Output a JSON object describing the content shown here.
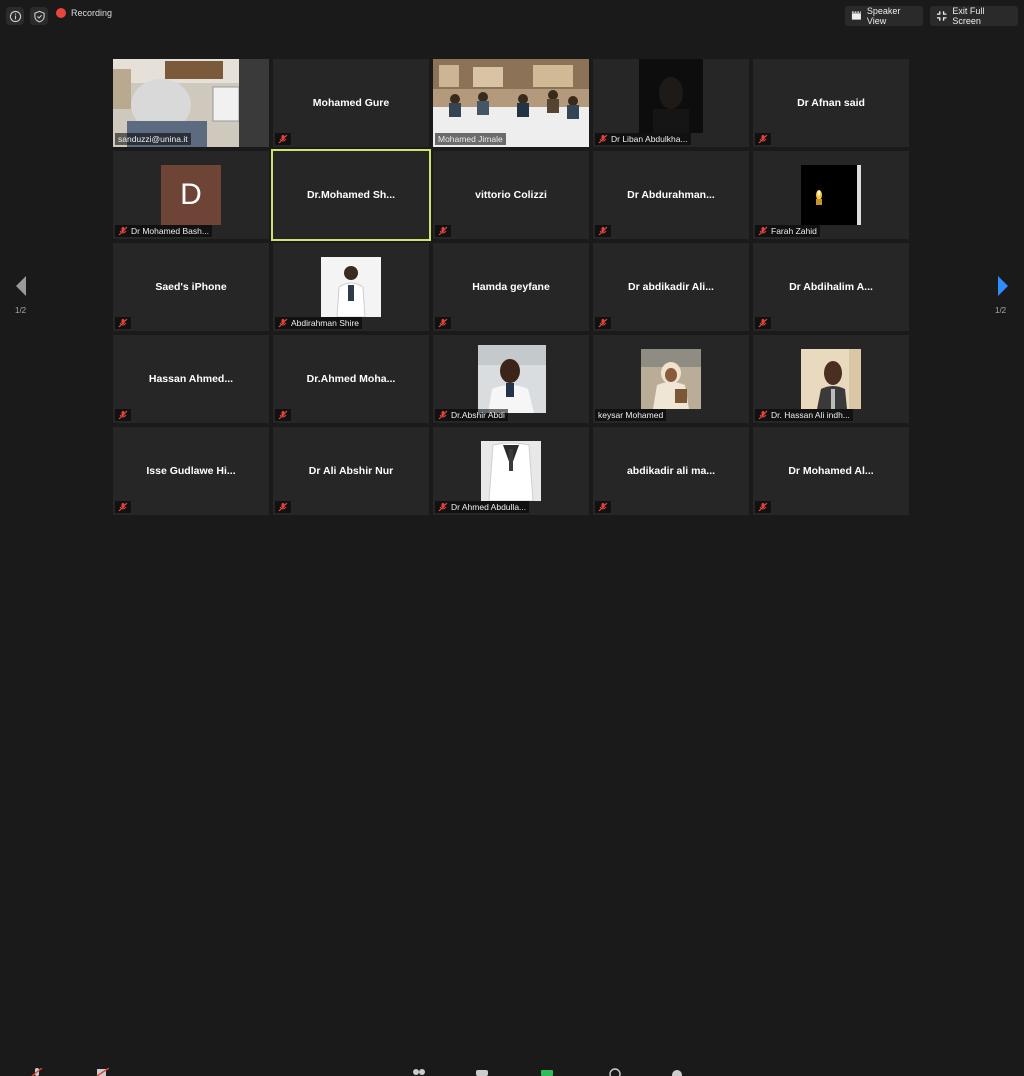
{
  "topbar": {
    "recording_label": "Recording",
    "speaker_view_label": "Speaker View",
    "exit_full_screen_label": "Exit Full Screen"
  },
  "colors": {
    "background": "#1a1a1a",
    "tile": "#262626",
    "active_border": "#cfe56a",
    "recording": "#e8453c",
    "muted": "#e0453a",
    "nav_arrow_right": "#2d8cff",
    "nav_arrow_left": "#9a9a9a"
  },
  "nav": {
    "left_page": "1/2",
    "right_page": "1/2"
  },
  "tiles": [
    {
      "label": "sanduzzi@unina.it",
      "kind": "video"
    },
    {
      "name": "Mohamed Gure",
      "kind": "name"
    },
    {
      "label": "Mohamed Jimale",
      "kind": "video"
    },
    {
      "label": "Dr Liban Abdulkha...",
      "kind": "video"
    },
    {
      "name": "Dr Afnan said",
      "kind": "name"
    },
    {
      "label": "Dr Mohamed Bash...",
      "avatar": "D",
      "kind": "avatar"
    },
    {
      "name": "Dr.Mohamed  Sh...",
      "kind": "name",
      "active": true
    },
    {
      "name": "vittorio Colizzi",
      "kind": "name"
    },
    {
      "name": "Dr  Abdurahman...",
      "kind": "name"
    },
    {
      "label": "Farah Zahid",
      "kind": "video"
    },
    {
      "name": "Saed's iPhone",
      "kind": "name"
    },
    {
      "label": "Abdirahman Shire",
      "kind": "video"
    },
    {
      "name": "Hamda geyfane",
      "kind": "name"
    },
    {
      "name": "Dr  abdikadir  Ali...",
      "kind": "name"
    },
    {
      "name": "Dr  Abdihalim  A...",
      "kind": "name"
    },
    {
      "name": "Hassan  Ahmed...",
      "kind": "name"
    },
    {
      "name": "Dr.Ahmed  Moha...",
      "kind": "name"
    },
    {
      "label": "Dr.Abshir Abdi",
      "kind": "video"
    },
    {
      "label": "keysar Mohamed",
      "kind": "video"
    },
    {
      "label": "Dr. Hassan Ali indh...",
      "kind": "video"
    },
    {
      "name": "Isse  Gudlawe  Hi...",
      "kind": "name"
    },
    {
      "name": "Dr Ali Abshir Nur",
      "kind": "name"
    },
    {
      "label": "Dr Ahmed Abdulla...",
      "kind": "video"
    },
    {
      "name": "abdikadir  ali  ma...",
      "kind": "name"
    },
    {
      "name": "Dr  Mohamed  Al...",
      "kind": "name"
    }
  ]
}
